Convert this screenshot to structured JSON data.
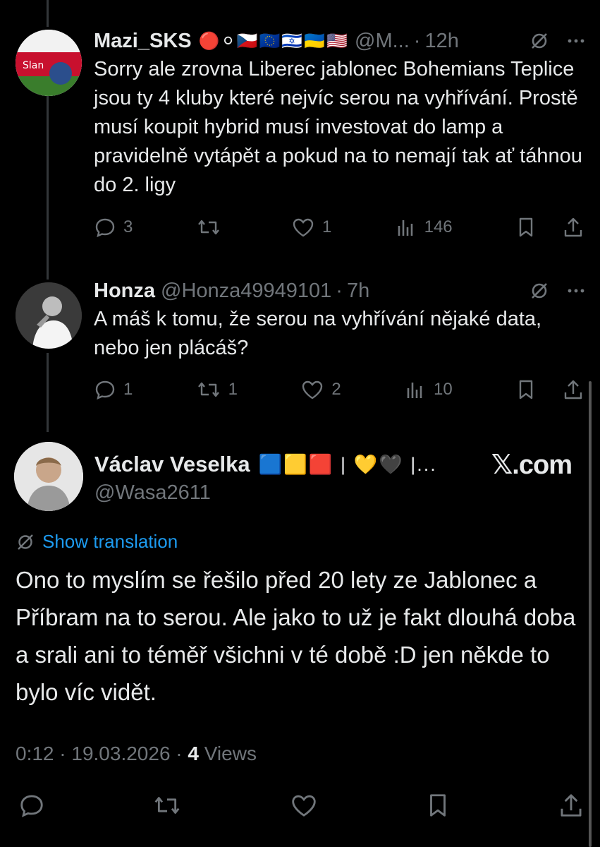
{
  "tweet1": {
    "name": "Mazi_SKS",
    "emoji_tail": "🔴⚪🇨🇿🇪🇺🇮🇱🇺🇦🇺🇸",
    "handle": "@M...",
    "time": "12h",
    "text": "Sorry ale zrovna Liberec jablonec Bohemians Teplice jsou ty 4 kluby které nejvíc serou na vyhřívání. Prostě musí koupit hybrid musí investovat do lamp a pravidelně vytápět a pokud na to nemají tak ať táhnou do 2. ligy",
    "replies": "3",
    "reposts": "",
    "likes": "1",
    "views": "146"
  },
  "tweet2": {
    "name": "Honza",
    "handle": "@Honza49949101",
    "time": "7h",
    "text": "A máš k tomu, že serou na vyhřívání nějaké data, nebo jen plácáš?",
    "replies": "1",
    "reposts": "1",
    "likes": "2",
    "views": "10"
  },
  "main": {
    "name": "Václav Veselka",
    "name_tail": "🟦🟨🟥 | 💛🖤 |...",
    "handle": "@Wasa2611",
    "brand": "𝕏.com",
    "show_translation": "Show translation",
    "text": "Ono to myslím se řešilo před 20 lety ze Jablonec a Příbram na to serou. Ale jako to už je fakt dlouhá doba a srali ani to téměř všichni v té době :D jen někde to bylo víc vidět.",
    "timestamp": "0:12 · 19.03.2026 ·",
    "views_count": "4",
    "views_label": "Views"
  },
  "colors": {
    "background": "#000000",
    "text": "#e7e9ea",
    "muted": "#71767b",
    "accent": "#1d9bf0"
  }
}
